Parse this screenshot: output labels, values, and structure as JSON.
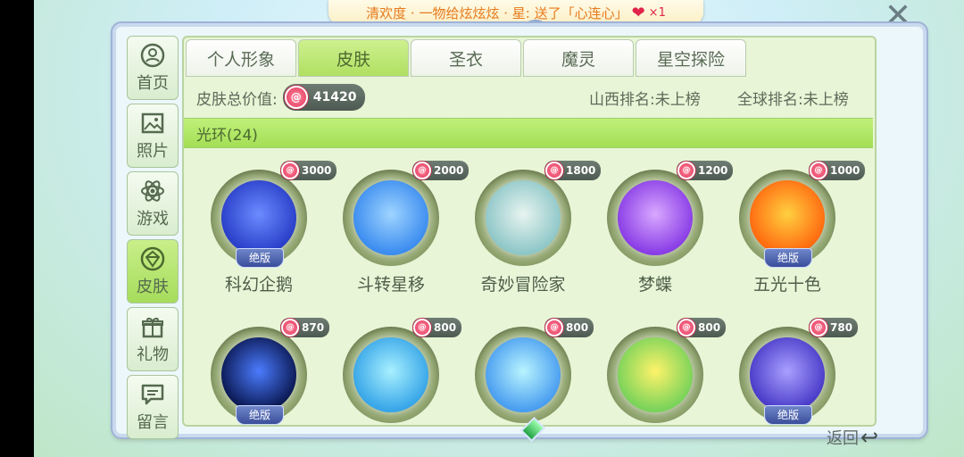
{
  "ticker": {
    "text": "清欢度 · 一物给炫炫炫 · 星: 送了「心连心」",
    "count": "×1"
  },
  "sidebar": {
    "items": [
      {
        "label": "首页",
        "icon": "home-icon"
      },
      {
        "label": "照片",
        "icon": "photo-icon"
      },
      {
        "label": "游戏",
        "icon": "atom-icon"
      },
      {
        "label": "皮肤",
        "icon": "diamond-icon"
      },
      {
        "label": "礼物",
        "icon": "gift-icon"
      },
      {
        "label": "留言",
        "icon": "message-icon"
      }
    ],
    "active_index": 3
  },
  "tabs": [
    "个人形象",
    "皮肤",
    "圣衣",
    "魔灵",
    "星空探险"
  ],
  "active_tab": 1,
  "summary": {
    "total_label": "皮肤总价值:",
    "total_value": "41420",
    "rank_local": "山西排名:未上榜",
    "rank_global": "全球排名:未上榜"
  },
  "category": {
    "label": "光环(24)"
  },
  "items": [
    {
      "name": "科幻企鹅",
      "price": "3000",
      "badge": "绝版",
      "colors": [
        "#2a3fc9",
        "#6b8cff"
      ]
    },
    {
      "name": "斗转星移",
      "price": "2000",
      "badge": "",
      "colors": [
        "#3c8df0",
        "#9fd4ff"
      ]
    },
    {
      "name": "奇妙冒险家",
      "price": "1800",
      "badge": "",
      "colors": [
        "#8fc7c8",
        "#e7f4f0"
      ]
    },
    {
      "name": "梦蝶",
      "price": "1200",
      "badge": "",
      "colors": [
        "#8a3ee6",
        "#d9a8ff"
      ]
    },
    {
      "name": "五光十色",
      "price": "1000",
      "badge": "绝版",
      "colors": [
        "#ff6a10",
        "#ffd040"
      ]
    },
    {
      "name": "",
      "price": "870",
      "badge": "绝版",
      "colors": [
        "#0c1a55",
        "#4b7cff"
      ]
    },
    {
      "name": "",
      "price": "800",
      "badge": "",
      "colors": [
        "#38a6e8",
        "#a8f0ff"
      ]
    },
    {
      "name": "",
      "price": "800",
      "badge": "",
      "colors": [
        "#4a9ef0",
        "#b8f4ff"
      ]
    },
    {
      "name": "",
      "price": "800",
      "badge": "",
      "colors": [
        "#7ad35a",
        "#fff36a"
      ]
    },
    {
      "name": "",
      "price": "780",
      "badge": "绝版",
      "colors": [
        "#4b3cc9",
        "#a8a0ff"
      ]
    }
  ],
  "back": {
    "label": "返回"
  }
}
